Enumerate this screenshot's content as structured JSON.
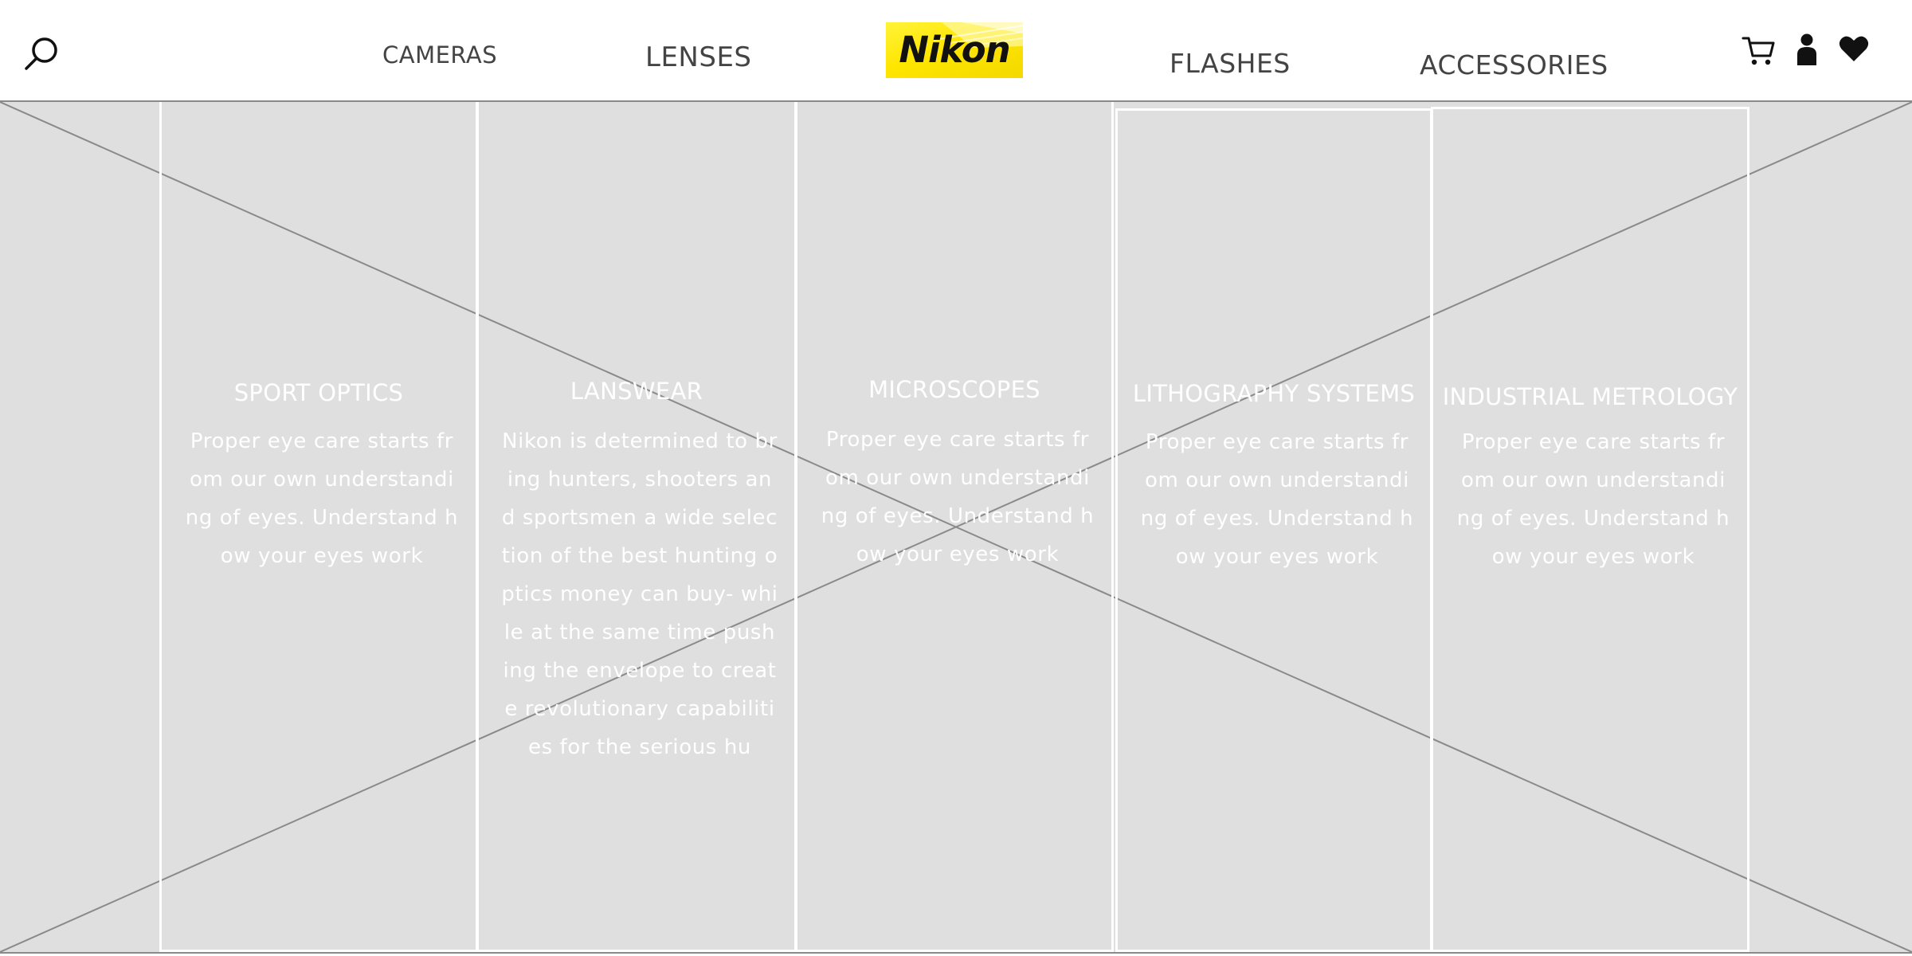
{
  "header": {
    "nav": {
      "cameras": "CAMERAS",
      "lenses": "LENSES",
      "flashes": "FLASHES",
      "accessories": "ACCESSORIES"
    },
    "logo_text": "Nikon",
    "icons": [
      "search-icon",
      "cart-icon",
      "user-icon",
      "heart-icon"
    ]
  },
  "panels": [
    {
      "title": "SPORT OPTICS",
      "body": "Proper eye care starts from our own understanding of eyes. Understand how your eyes work"
    },
    {
      "title": "LANSWEAR",
      "body": "Nikon is determined to bring hunters, shooters and sportsmen a wide selection of the best hunting optics money can buy- while at the same time pushing the envelope to create revolutionary capabilities for the serious hu"
    },
    {
      "title": "MICROSCOPES",
      "body": "Proper eye care starts from our own understanding of eyes. Understand how your eyes work"
    },
    {
      "title": "LITHOGRAPHY SYSTEMS",
      "body": "Proper eye care starts from our own understanding of eyes. Understand how your eyes work"
    },
    {
      "title": "INDUSTRIAL METROLOGY",
      "body": "Proper eye care starts from our own understanding of eyes. Understand how your eyes work"
    }
  ],
  "colors": {
    "logo_yellow": "#ffe600",
    "placeholder_gray": "#dfdfdf",
    "nav_text": "#444444"
  }
}
